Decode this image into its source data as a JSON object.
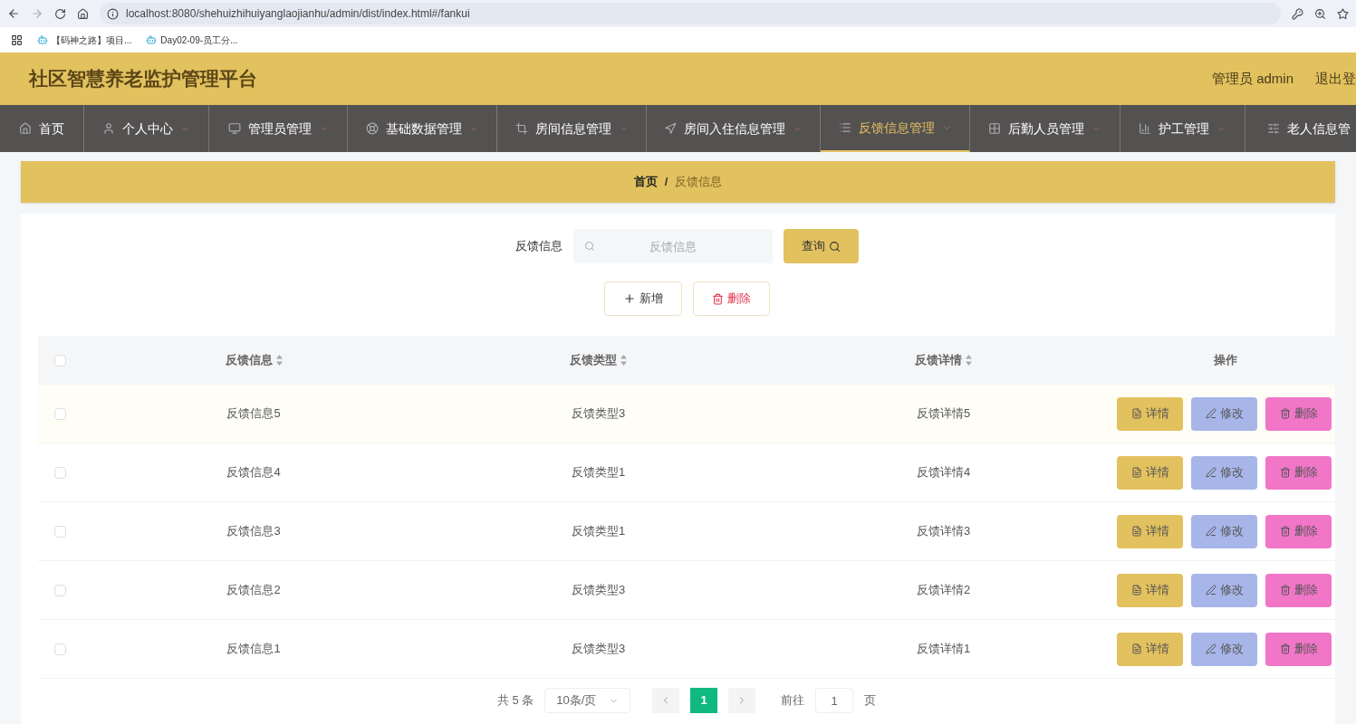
{
  "browser": {
    "url": "localhost:8080/shehuizhihuiyanglaojianhu/admin/dist/index.html#/fankui",
    "bookmarks": [
      "【码神之路】项目...",
      "Day02-09-员工分..."
    ]
  },
  "header": {
    "title": "社区智慧养老监护管理平台",
    "user": "管理员 admin",
    "logout": "退出登"
  },
  "nav": [
    {
      "label": "首页",
      "selected": false,
      "dropdown": false
    },
    {
      "label": "个人中心",
      "selected": false,
      "dropdown": true
    },
    {
      "label": "管理员管理",
      "selected": false,
      "dropdown": true
    },
    {
      "label": "基础数据管理",
      "selected": false,
      "dropdown": true
    },
    {
      "label": "房间信息管理",
      "selected": false,
      "dropdown": true
    },
    {
      "label": "房间入住信息管理",
      "selected": false,
      "dropdown": true
    },
    {
      "label": "反馈信息管理",
      "selected": true,
      "dropdown": true
    },
    {
      "label": "后勤人员管理",
      "selected": false,
      "dropdown": true
    },
    {
      "label": "护工管理",
      "selected": false,
      "dropdown": true
    },
    {
      "label": "老人信息管",
      "selected": false,
      "dropdown": false
    }
  ],
  "breadcrumb": {
    "items": [
      "首页",
      "反馈信息"
    ],
    "separator": "/"
  },
  "search": {
    "label": "反馈信息",
    "placeholder": "反馈信息",
    "button": "查询"
  },
  "actions": [
    {
      "kind": "add",
      "label": "新增"
    },
    {
      "kind": "delete",
      "label": "删除"
    }
  ],
  "table": {
    "select_all": {
      "checked": false
    },
    "columns": [
      {
        "label": "反馈信息",
        "sortable": true
      },
      {
        "label": "反馈类型",
        "sortable": true
      },
      {
        "label": "反馈详情",
        "sortable": true
      },
      {
        "label": "操作",
        "sortable": false
      }
    ],
    "rows": [
      {
        "checked": false,
        "cells": [
          "反馈信息5",
          "反馈类型3",
          "反馈详情5"
        ],
        "actions": [
          {
            "kind": "detail",
            "label": "详情"
          },
          {
            "kind": "edit",
            "label": "修改"
          },
          {
            "kind": "delete",
            "label": "删除"
          }
        ]
      },
      {
        "checked": false,
        "cells": [
          "反馈信息4",
          "反馈类型1",
          "反馈详情4"
        ],
        "actions": [
          {
            "kind": "detail",
            "label": "详情"
          },
          {
            "kind": "edit",
            "label": "修改"
          },
          {
            "kind": "delete",
            "label": "删除"
          }
        ]
      },
      {
        "checked": false,
        "cells": [
          "反馈信息3",
          "反馈类型1",
          "反馈详情3"
        ],
        "actions": [
          {
            "kind": "detail",
            "label": "详情"
          },
          {
            "kind": "edit",
            "label": "修改"
          },
          {
            "kind": "delete",
            "label": "删除"
          }
        ]
      },
      {
        "checked": false,
        "cells": [
          "反馈信息2",
          "反馈类型3",
          "反馈详情2"
        ],
        "actions": [
          {
            "kind": "detail",
            "label": "详情"
          },
          {
            "kind": "edit",
            "label": "修改"
          },
          {
            "kind": "delete",
            "label": "删除"
          }
        ]
      },
      {
        "checked": false,
        "cells": [
          "反馈信息1",
          "反馈类型3",
          "反馈详情1"
        ],
        "actions": [
          {
            "kind": "detail",
            "label": "详情"
          },
          {
            "kind": "edit",
            "label": "修改"
          },
          {
            "kind": "delete",
            "label": "删除"
          }
        ]
      }
    ]
  },
  "pagination": {
    "total": "共 5 条",
    "page_size": "10条/页",
    "pages": [
      {
        "label": "1",
        "selected": true
      }
    ],
    "goto_label": "前往",
    "goto_value": "1",
    "goto_suffix": "页"
  }
}
